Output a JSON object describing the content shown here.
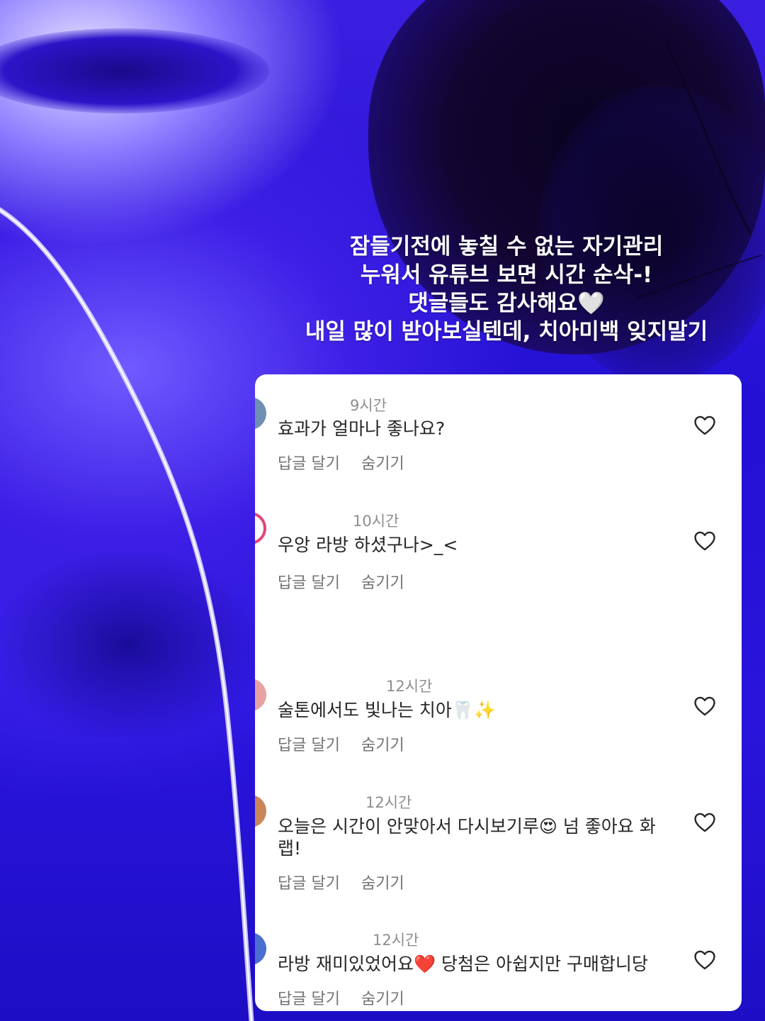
{
  "caption": {
    "lines": [
      "잠들기전에 놓칠 수 없는 자기관리",
      "누워서 유튜브 보면 시간 순삭-!",
      "댓글들도 감사해요🤍",
      "내일 많이 받아보실텐데, 치아미백 잊지말기"
    ]
  },
  "comments": [
    {
      "time": "9시간",
      "text": "효과가 얼마나 좋나요?",
      "reply": "답글 달기",
      "hide": "숨기기",
      "avatar_color": "#6f8fb3"
    },
    {
      "time": "10시간",
      "text": "우앙 라방 하셨구나>_<",
      "reply": "답글 달기",
      "hide": "숨기기",
      "avatar_color": "#e0457b"
    },
    {
      "time": "12시간",
      "text": "술톤에서도 빛나는 치아🦷✨",
      "reply": "답글 달기",
      "hide": "숨기기",
      "avatar_color": "#e7a3a3"
    },
    {
      "time": "12시간",
      "text": "오늘은 시간이 안맞아서 다시보기루😍 넘 좋아요 화랩!",
      "reply": "답글 달기",
      "hide": "숨기기",
      "avatar_color": "#c9865a"
    },
    {
      "time": "12시간",
      "text": "라방 재미있었어요❤️ 당첨은 아쉽지만 구매합니당",
      "reply": "답글 달기",
      "hide": "숨기기",
      "avatar_color": "#4b6ed1"
    }
  ],
  "icons": {
    "like": "heart-outline-icon"
  },
  "colors": {
    "background_tint": "#2a12d8",
    "panel": "#ffffff",
    "meta_text": "#8e8e8e"
  }
}
